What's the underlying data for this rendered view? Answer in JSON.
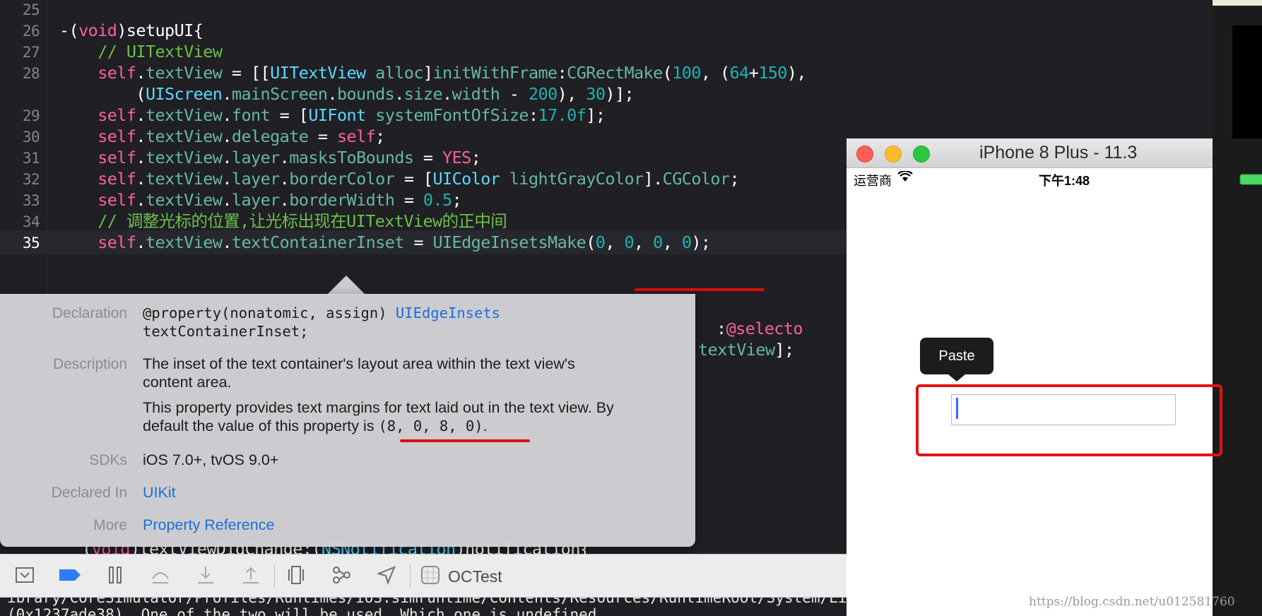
{
  "editor": {
    "lines": [
      {
        "n": "25",
        "parts": []
      },
      {
        "n": "26",
        "parts": [
          [
            "",
            "-("
          ],
          [
            "kw",
            "void"
          ],
          [
            "",
            ")setupUI{"
          ]
        ]
      },
      {
        "n": "27",
        "parts": [
          [
            "",
            "    "
          ],
          [
            "cm",
            "// UITextView"
          ]
        ]
      },
      {
        "n": "28",
        "parts": [
          [
            "",
            "    "
          ],
          [
            "kw",
            "self"
          ],
          [
            "",
            "."
          ],
          [
            "prop",
            "textView"
          ],
          [
            "",
            " = [["
          ],
          [
            "cls",
            "UITextView"
          ],
          [
            "",
            " "
          ],
          [
            "meth",
            "alloc"
          ],
          [
            "",
            "]"
          ],
          [
            "meth",
            "initWithFrame"
          ],
          [
            "",
            ":"
          ],
          [
            "meth",
            "CGRectMake"
          ],
          [
            "",
            "("
          ],
          [
            "num",
            "100"
          ],
          [
            "",
            ", ("
          ],
          [
            "num",
            "64"
          ],
          [
            "",
            "+"
          ],
          [
            "num",
            "150"
          ],
          [
            "",
            "),"
          ]
        ]
      },
      {
        "n": "",
        "parts": [
          [
            "",
            "        ("
          ],
          [
            "cls",
            "UIScreen"
          ],
          [
            "",
            "."
          ],
          [
            "meth",
            "mainScreen"
          ],
          [
            "",
            "."
          ],
          [
            "prop",
            "bounds"
          ],
          [
            "",
            "."
          ],
          [
            "prop",
            "size"
          ],
          [
            "",
            "."
          ],
          [
            "prop",
            "width"
          ],
          [
            "",
            " - "
          ],
          [
            "num",
            "200"
          ],
          [
            "",
            "), "
          ],
          [
            "num",
            "30"
          ],
          [
            "",
            ")];"
          ]
        ]
      },
      {
        "n": "29",
        "parts": [
          [
            "",
            "    "
          ],
          [
            "kw",
            "self"
          ],
          [
            "",
            "."
          ],
          [
            "prop",
            "textView"
          ],
          [
            "",
            "."
          ],
          [
            "prop",
            "font"
          ],
          [
            "",
            " = ["
          ],
          [
            "cls",
            "UIFont"
          ],
          [
            "",
            " "
          ],
          [
            "meth",
            "systemFontOfSize"
          ],
          [
            "",
            ":"
          ],
          [
            "num",
            "17.0f"
          ],
          [
            "",
            "];"
          ]
        ]
      },
      {
        "n": "30",
        "parts": [
          [
            "",
            "    "
          ],
          [
            "kw",
            "self"
          ],
          [
            "",
            "."
          ],
          [
            "prop",
            "textView"
          ],
          [
            "",
            "."
          ],
          [
            "prop",
            "delegate"
          ],
          [
            "",
            " = "
          ],
          [
            "kw",
            "self"
          ],
          [
            "",
            ";"
          ]
        ]
      },
      {
        "n": "31",
        "parts": [
          [
            "",
            "    "
          ],
          [
            "kw",
            "self"
          ],
          [
            "",
            "."
          ],
          [
            "prop",
            "textView"
          ],
          [
            "",
            "."
          ],
          [
            "prop",
            "layer"
          ],
          [
            "",
            "."
          ],
          [
            "prop",
            "masksToBounds"
          ],
          [
            "",
            " = "
          ],
          [
            "kw",
            "YES"
          ],
          [
            "",
            ";"
          ]
        ]
      },
      {
        "n": "32",
        "parts": [
          [
            "",
            "    "
          ],
          [
            "kw",
            "self"
          ],
          [
            "",
            "."
          ],
          [
            "prop",
            "textView"
          ],
          [
            "",
            "."
          ],
          [
            "prop",
            "layer"
          ],
          [
            "",
            "."
          ],
          [
            "prop",
            "borderColor"
          ],
          [
            "",
            " = ["
          ],
          [
            "cls",
            "UIColor"
          ],
          [
            "",
            " "
          ],
          [
            "meth",
            "lightGrayColor"
          ],
          [
            "",
            "]."
          ],
          [
            "prop",
            "CGColor"
          ],
          [
            "",
            ";"
          ]
        ]
      },
      {
        "n": "33",
        "parts": [
          [
            "",
            "    "
          ],
          [
            "kw",
            "self"
          ],
          [
            "",
            "."
          ],
          [
            "prop",
            "textView"
          ],
          [
            "",
            "."
          ],
          [
            "prop",
            "layer"
          ],
          [
            "",
            "."
          ],
          [
            "prop",
            "borderWidth"
          ],
          [
            "",
            " = "
          ],
          [
            "num",
            "0.5"
          ],
          [
            "",
            ";"
          ]
        ]
      },
      {
        "n": "34",
        "parts": [
          [
            "",
            "    "
          ],
          [
            "cm",
            "// 调整光标的位置,让光标出现在UITextView的正中间"
          ]
        ]
      },
      {
        "n": "35",
        "parts": [
          [
            "",
            "    "
          ],
          [
            "kw",
            "self"
          ],
          [
            "",
            "."
          ],
          [
            "prop",
            "textView"
          ],
          [
            "",
            "."
          ],
          [
            "prop",
            "textContainerInset"
          ],
          [
            "",
            " = "
          ],
          [
            "meth",
            "UIEdgeInsetsMake"
          ],
          [
            "",
            "("
          ],
          [
            "num",
            "0"
          ],
          [
            "",
            ", "
          ],
          [
            "num",
            "0"
          ],
          [
            "",
            ", "
          ],
          [
            "num",
            "0"
          ],
          [
            "",
            ", "
          ],
          [
            "num",
            "0"
          ],
          [
            "",
            ");"
          ]
        ]
      }
    ],
    "fragment_selector_line": [
      [
        "",
        ":"
      ],
      [
        "sel",
        "@selecto"
      ]
    ],
    "fragment_textview_line": [
      [
        "prop",
        "textView"
      ],
      [
        "",
        "];"
      ]
    ],
    "fragment_bottom_line": [
      [
        "",
        "    ("
      ],
      [
        "kw",
        "void"
      ],
      [
        "",
        ")textViewDidChange:("
      ],
      [
        "cls",
        "NSNotification"
      ],
      [
        "",
        ")notification{"
      ]
    ]
  },
  "quickhelp": {
    "declaration_label": "Declaration",
    "declaration_line1_prefix": "@property(nonatomic, assign) ",
    "declaration_line1_type": "UIEdgeInsets",
    "declaration_line2": "textContainerInset;",
    "description_label": "Description",
    "description_p1_line1": "The inset of the text container's layout area within the text view's",
    "description_p1_line2": "content area.",
    "description_p2_line1": "This property provides text margins for text laid out in the text view. By",
    "description_p2_line2_prefix": "default the value of this property is ",
    "description_p2_line2_code": "(8, 0, 8, 0)",
    "description_p2_line2_suffix": ".",
    "sdks_label": "SDKs",
    "sdks_value": "iOS 7.0+, tvOS 9.0+",
    "declared_in_label": "Declared In",
    "declared_in_value": "UIKit",
    "more_label": "More",
    "more_value": "Property Reference"
  },
  "debugbar": {
    "scheme_name": "OCTest",
    "icons": [
      "hide-debug-area-icon",
      "breakpoint-icon",
      "pause-icon",
      "step-over-icon",
      "step-into-icon",
      "step-out-icon",
      "view-debugger-icon",
      "memory-graph-icon",
      "location-icon",
      "app-icon"
    ]
  },
  "console": {
    "line1": "ibrary/CoreSimulator/Profiles/Runtimes/iOS.simruntime/Contents/Resources/RuntimeRoot/System/Library/PrivateFrameworks/MobileCo",
    "line2": "(0x1237ade38). One of the two will be used. Which one is undefined."
  },
  "simulator": {
    "title": "iPhone 8 Plus - 11.3",
    "carrier": "运营商",
    "time": "下午1:48",
    "paste_label": "Paste"
  },
  "watermark": "https://blog.csdn.net/u012581760",
  "colors": {
    "editor_bg": "#1f1f24",
    "keyword": "#fc5fa3",
    "class": "#5dd8ff",
    "comment": "#6cc049",
    "number": "#1cb3b3",
    "annotation_red": "#e01414",
    "link": "#1b6fd6"
  }
}
